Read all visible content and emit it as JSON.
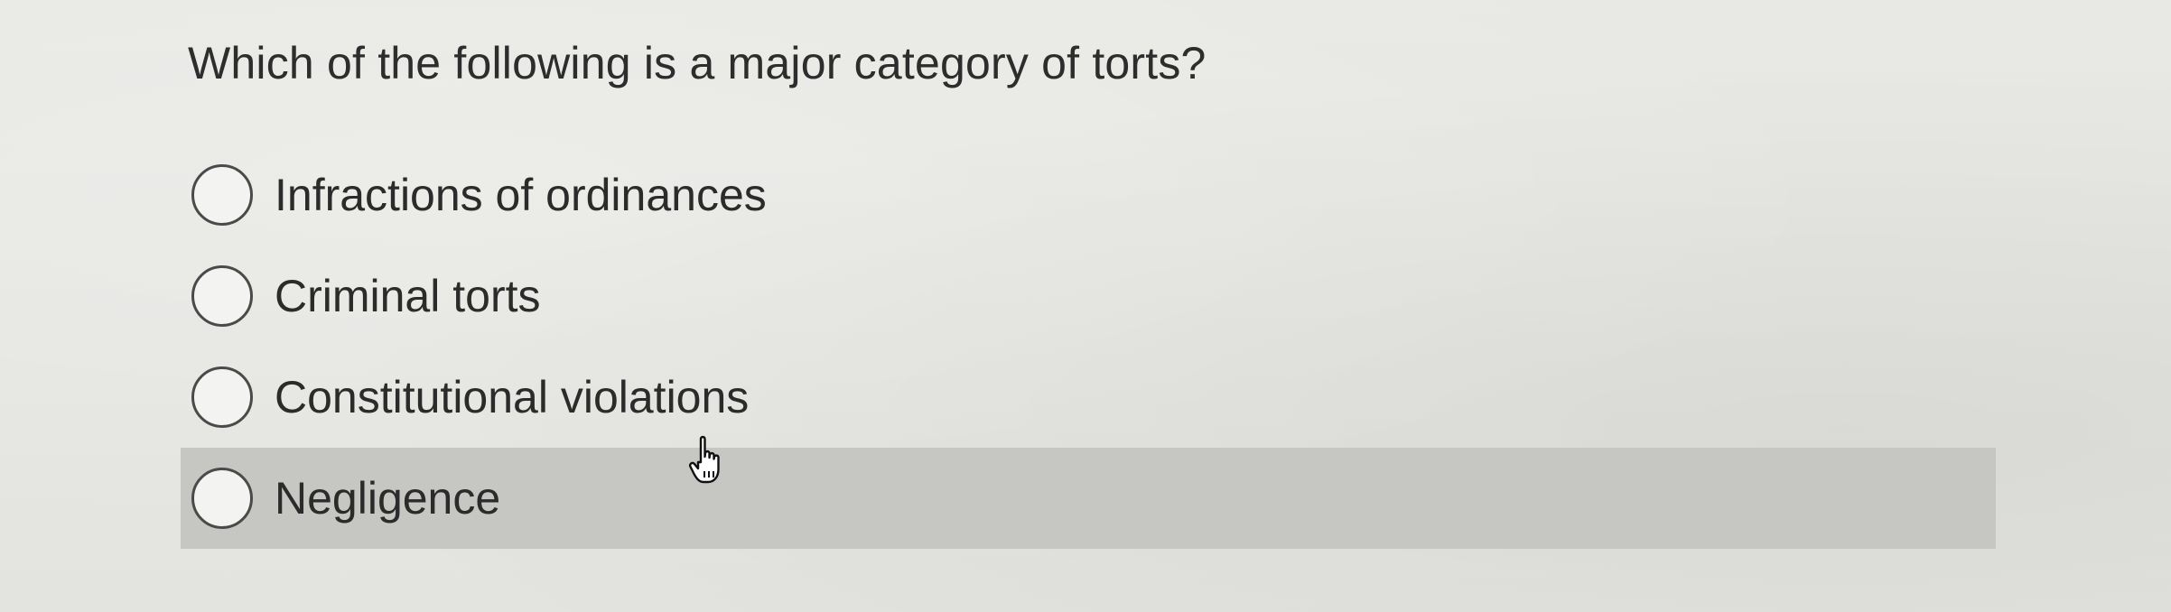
{
  "question": {
    "text": "Which of the following is a major category of torts?"
  },
  "options": [
    {
      "label": "Infractions of ordinances",
      "selected": false
    },
    {
      "label": "Criminal torts",
      "selected": false
    },
    {
      "label": "Constitutional violations",
      "selected": false
    },
    {
      "label": "Negligence",
      "selected": false,
      "hovered": true
    }
  ],
  "cursor": {
    "icon": "hand-pointer-icon"
  },
  "colors": {
    "background": "#e6e6e2",
    "hover_highlight": "#c6c6c2",
    "text": "#2b2b2b",
    "radio_border": "#4a4a4a"
  }
}
